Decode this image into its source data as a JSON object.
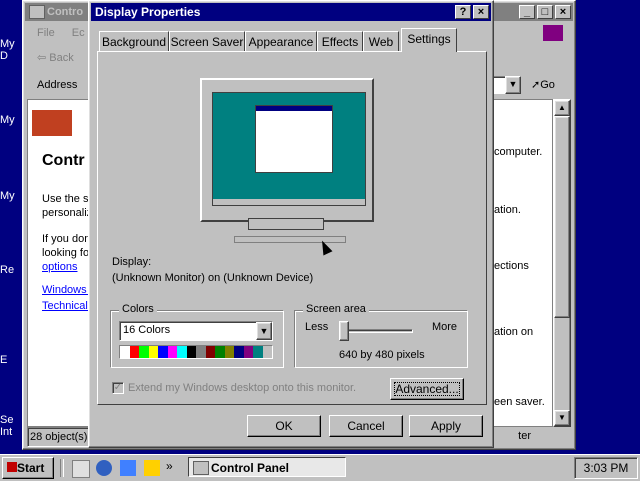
{
  "desktop": {
    "icon_labels": [
      "My D",
      "My",
      "My",
      "Re",
      "E",
      "Se\nInt"
    ]
  },
  "control_panel": {
    "title": "Contro",
    "menu": [
      "File",
      "Ec"
    ],
    "back_label": "Back",
    "address_label": "Address",
    "go_label": "Go",
    "heading": "Contr",
    "body_lines": [
      "Use the se",
      "personaliz"
    ],
    "body2_lines": [
      "If you don",
      "looking for"
    ],
    "options_link": "options",
    "links": [
      "Windows U",
      "Technical S"
    ],
    "right_text": [
      "computer.",
      "ation.",
      "ections",
      "ation on",
      "een saver."
    ],
    "status": "28 object(s)",
    "status_right": "ter"
  },
  "dialog": {
    "title": "Display Properties",
    "help_glyph": "?",
    "close_glyph": "×",
    "tabs": [
      "Background",
      "Screen Saver",
      "Appearance",
      "Effects",
      "Web",
      "Settings"
    ],
    "active_tab": "Settings",
    "display_label": "Display:",
    "display_value": "(Unknown Monitor) on (Unknown Device)",
    "colors_label": "Colors",
    "colors_value": "16 Colors",
    "palette": [
      "#ffffff",
      "#ff0000",
      "#00ff00",
      "#ffff00",
      "#0000ff",
      "#ff00ff",
      "#00ffff",
      "#000000",
      "#808080",
      "#800000",
      "#008000",
      "#808000",
      "#000080",
      "#800080",
      "#008080",
      "#c0c0c0"
    ],
    "screen_area_label": "Screen area",
    "less_label": "Less",
    "more_label": "More",
    "resolution_text": "640 by 480 pixels",
    "resolution_level": 0,
    "extend_label": "Extend my Windows desktop onto this monitor.",
    "extend_checked": true,
    "advanced_label": "Advanced...",
    "ok_label": "OK",
    "cancel_label": "Cancel",
    "apply_label": "Apply"
  },
  "taskbar": {
    "start_label": "Start",
    "task_label": "Control Panel",
    "clock": "3:03 PM",
    "more_glyph": "»"
  }
}
